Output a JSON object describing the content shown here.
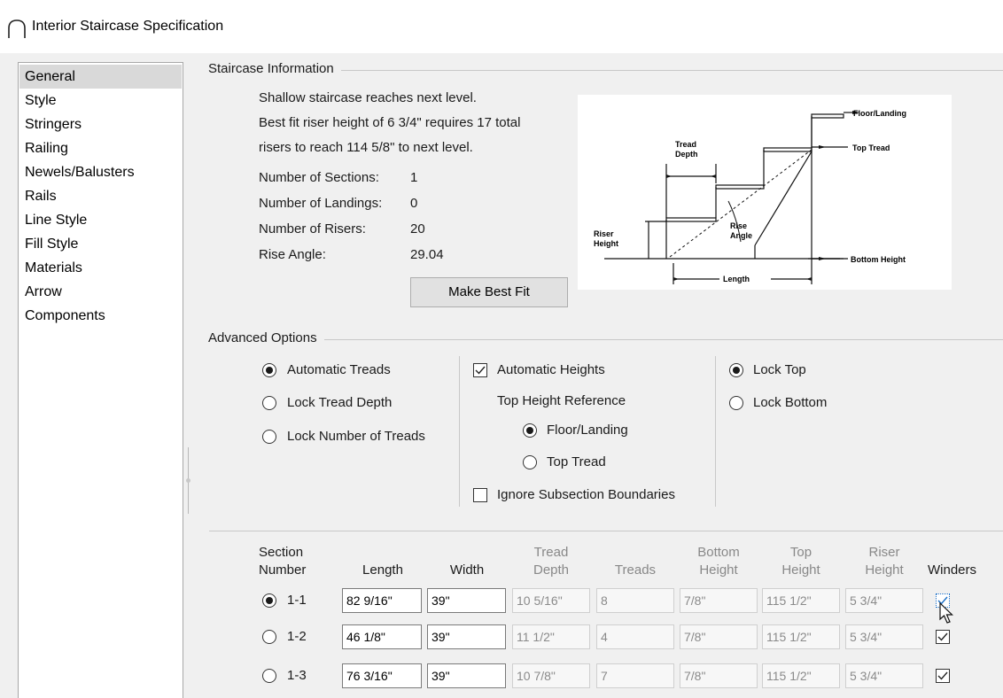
{
  "window": {
    "title": "Interior Staircase Specification"
  },
  "sidebar": {
    "items": [
      {
        "label": "General",
        "selected": true
      },
      {
        "label": "Style"
      },
      {
        "label": "Stringers"
      },
      {
        "label": "Railing"
      },
      {
        "label": "Newels/Balusters"
      },
      {
        "label": "Rails"
      },
      {
        "label": "Line Style"
      },
      {
        "label": "Fill Style"
      },
      {
        "label": "Materials"
      },
      {
        "label": "Arrow"
      },
      {
        "label": "Components"
      }
    ]
  },
  "staircase_info": {
    "group_title": "Staircase Information",
    "message_line1": "Shallow staircase reaches next level.",
    "message_line2": "Best fit riser height of 6 3/4\" requires 17 total",
    "message_line3": "risers to reach 114 5/8\" to next level.",
    "sections_label": "Number of Sections:",
    "sections_value": "1",
    "landings_label": "Number of Landings:",
    "landings_value": "0",
    "risers_label": "Number of Risers:",
    "risers_value": "20",
    "rise_angle_label": "Rise Angle:",
    "rise_angle_value": "29.04",
    "best_fit_button": "Make Best Fit"
  },
  "diagram": {
    "floor_landing": "Floor/Landing",
    "top_tread": "Top Tread",
    "tread": "Tread",
    "depth": "Depth",
    "riser": "Riser",
    "height": "Height",
    "rise": "Rise",
    "angle": "Angle",
    "bottom_height": "Bottom Height",
    "length": "Length"
  },
  "advanced": {
    "group_title": "Advanced Options",
    "automatic_treads": "Automatic Treads",
    "lock_tread_depth": "Lock Tread Depth",
    "lock_number_treads": "Lock Number of Treads",
    "automatic_heights": "Automatic Heights",
    "top_height_reference": "Top Height Reference",
    "floor_landing": "Floor/Landing",
    "top_tread": "Top Tread",
    "ignore_subsection": "Ignore Subsection Boundaries",
    "lock_top": "Lock Top",
    "lock_bottom": "Lock Bottom"
  },
  "table": {
    "headers": {
      "section_1": "Section",
      "section_2": "Number",
      "length": "Length",
      "width": "Width",
      "tread_1": "Tread",
      "tread_2": "Depth",
      "treads": "Treads",
      "bottom_1": "Bottom",
      "bottom_2": "Height",
      "top_1": "Top",
      "top_2": "Height",
      "riser_1": "Riser",
      "riser_2": "Height",
      "winders": "Winders"
    },
    "rows": [
      {
        "section": "1-1",
        "length": "82 9/16\"",
        "width": "39\"",
        "tread_depth": "10 5/16\"",
        "treads": "8",
        "bottom_height": "7/8\"",
        "top_height": "115 1/2\"",
        "riser_height": "5 3/4\"",
        "winders": true,
        "selected": true
      },
      {
        "section": "1-2",
        "length": "46 1/8\"",
        "width": "39\"",
        "tread_depth": "11 1/2\"",
        "treads": "4",
        "bottom_height": "7/8\"",
        "top_height": "115 1/2\"",
        "riser_height": "5 3/4\"",
        "winders": true,
        "selected": false
      },
      {
        "section": "1-3",
        "length": "76 3/16\"",
        "width": "39\"",
        "tread_depth": "10 7/8\"",
        "treads": "7",
        "bottom_height": "7/8\"",
        "top_height": "115 1/2\"",
        "riser_height": "5 3/4\"",
        "winders": true,
        "selected": false
      }
    ]
  }
}
